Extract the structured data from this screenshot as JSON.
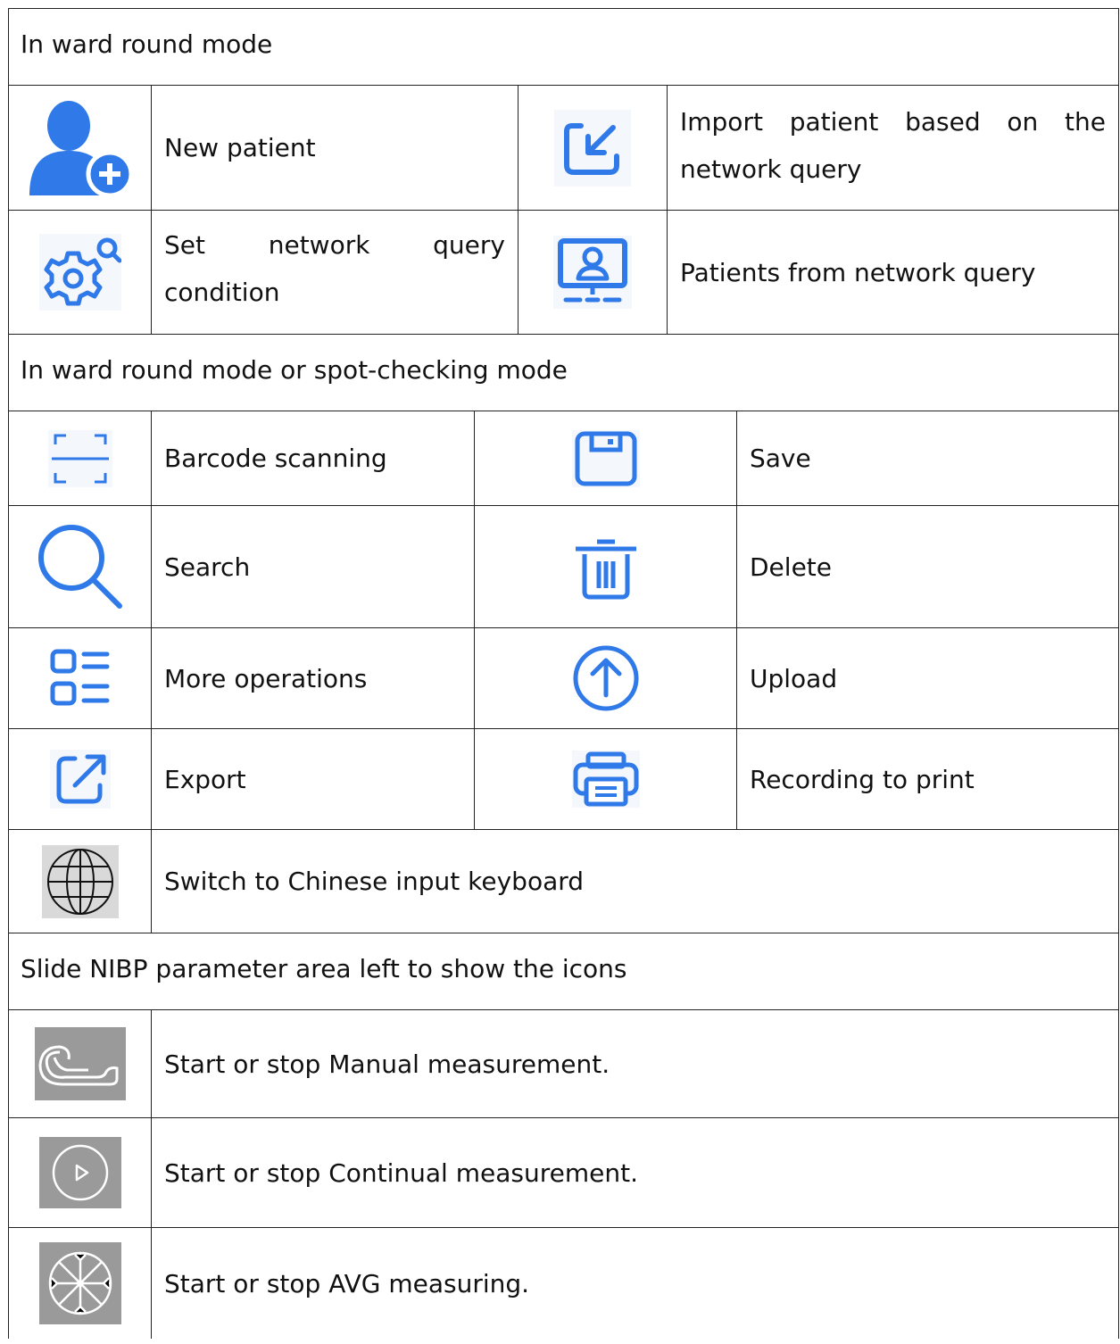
{
  "sections": {
    "ward_round": "In ward round mode",
    "ward_or_spot": "In ward round mode or spot-checking mode",
    "nibp": "Slide NIBP parameter area left to show the icons"
  },
  "items": {
    "new_patient": "New patient",
    "import_patient": "Import patient based on the network query",
    "set_query": "Set network query condition",
    "patients_query": "Patients from network query",
    "barcode": "Barcode scanning",
    "save": "Save",
    "search": "Search",
    "delete": "Delete",
    "more": "More operations",
    "upload": "Upload",
    "export": "Export",
    "print": "Recording to print",
    "keyboard": "Switch to Chinese input keyboard",
    "manual": "Start or stop Manual measurement.",
    "continual": "Start or stop Continual measurement.",
    "avg": "Start or stop AVG measuring."
  },
  "icons": [
    "new-patient-icon",
    "import-icon",
    "gear-search-icon",
    "monitor-user-icon",
    "barcode-scan-icon",
    "save-icon",
    "search-icon",
    "trash-icon",
    "grid-list-icon",
    "upload-icon",
    "export-icon",
    "printer-icon",
    "globe-icon",
    "cuff-icon",
    "play-circle-icon",
    "wheel-icon"
  ],
  "colors": {
    "accent": "#2f7ae8",
    "icon_bg_gray": "#9a9a9a",
    "text": "#111111"
  }
}
